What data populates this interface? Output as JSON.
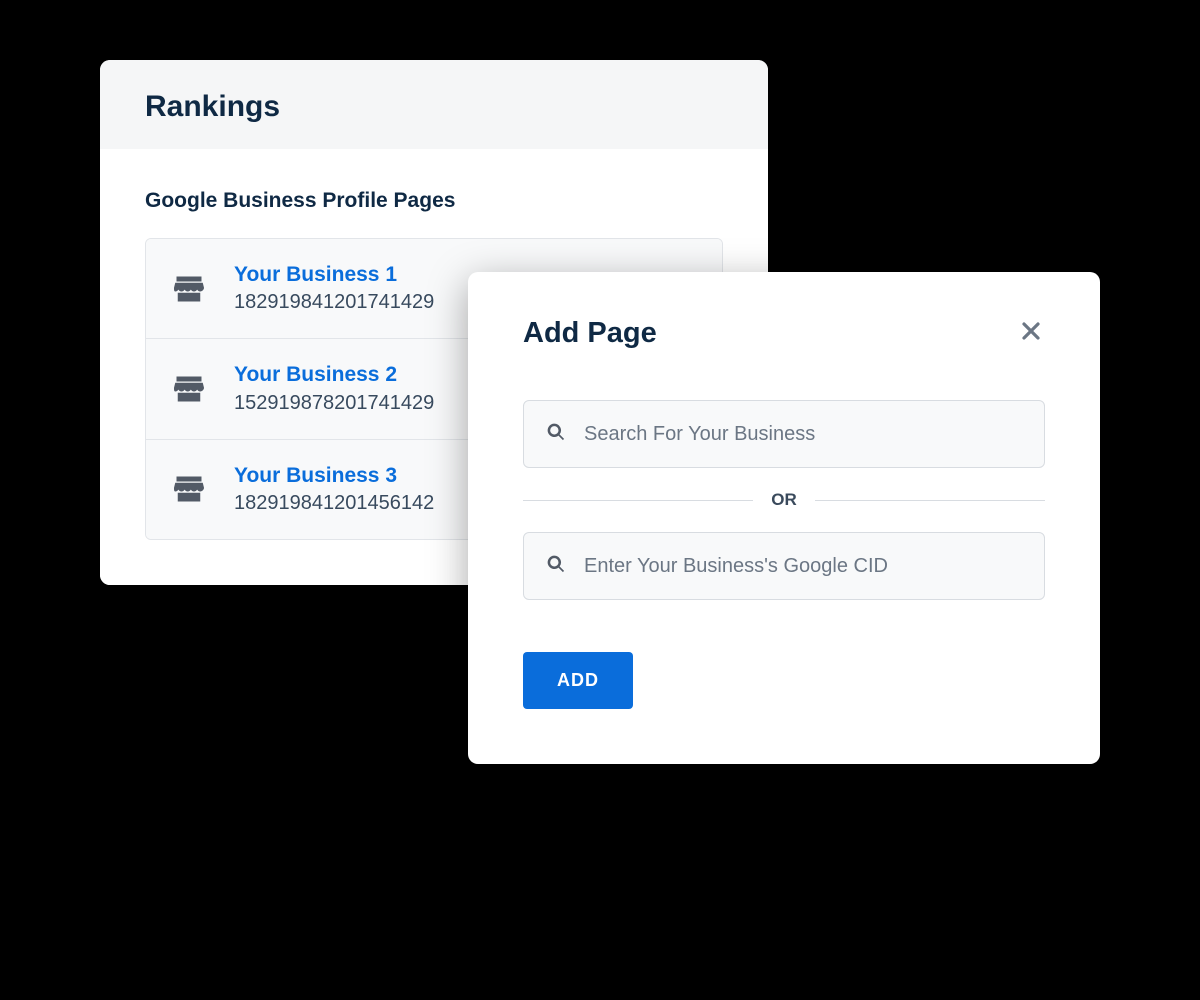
{
  "rankings": {
    "title": "Rankings",
    "section_title": "Google Business Profile Pages",
    "items": [
      {
        "name": "Your Business 1",
        "id": "182919841201741429"
      },
      {
        "name": "Your Business 2",
        "id": "152919878201741429"
      },
      {
        "name": "Your Business 3",
        "id": "182919841201456142"
      }
    ]
  },
  "modal": {
    "title": "Add Page",
    "search_placeholder": "Search For Your Business",
    "divider_text": "OR",
    "cid_placeholder": "Enter Your Business's Google CID",
    "add_button": "ADD"
  },
  "colors": {
    "accent_blue": "#0a6ddb",
    "text_dark": "#0f2944"
  }
}
